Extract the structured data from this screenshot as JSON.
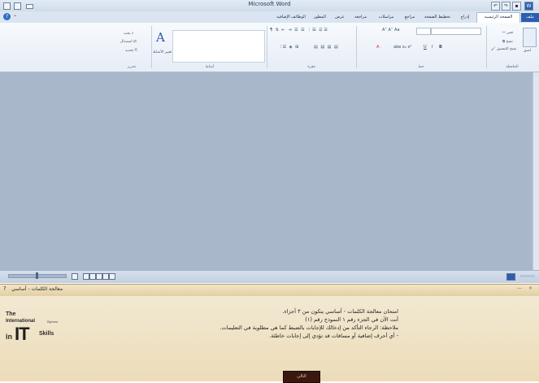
{
  "window": {
    "title": "Microsoft Word"
  },
  "ribbon_tabs": {
    "file": "ملف",
    "home": "الصفحة الرئيسية",
    "insert": "إدراج",
    "page_layout": "تخطيط الصفحة",
    "references": "مراجع",
    "mailings": "مراسلات",
    "review": "مراجعة",
    "view": "عرض",
    "developer": "المطور",
    "addins": "الوظائف الإضافية"
  },
  "clipboard": {
    "paste": "لصق",
    "cut": "قص",
    "copy": "نسخ",
    "format_painter": "نسخ التنسيق",
    "group_label": "الحافظة"
  },
  "font_group": {
    "label": "خط"
  },
  "paragraph_group": {
    "label": "فقرة"
  },
  "styles_group": {
    "label": "أنماط"
  },
  "editing_group": {
    "label": "تحرير",
    "find": "بحث",
    "replace": "استبدال",
    "select": "تحديد"
  },
  "change_styles_label": "تغيير الأنماط",
  "exam_panel": {
    "title": "معالجة الكلمات - أساسي",
    "logo": {
      "line1": "The",
      "line2": "International",
      "diploma": "Diploma",
      "in": "in",
      "it": "IT",
      "skills": "Skills"
    },
    "instructions": [
      "امتحان معالجة الكلمات - أساسي يتكون من ٣ أجزاء.",
      "أنت الآن في  الجزء رقم ١ النموذج رقم (١)",
      "ملاحظة: الرجاء التأكد من إدخالك للإجابات بالضبط كما هي مطلوبة في التعليمات.",
      "- أي أحرف إضافية أو مسافات قد تؤدي إلى إجابات خاطئة."
    ],
    "next_button": "التالي"
  },
  "icons": [
    "help-icon",
    "word-icon",
    "save-icon",
    "undo-icon",
    "redo-icon",
    "minimize-icon",
    "maximize-icon",
    "close-icon",
    "paste-icon",
    "cut-icon",
    "copy-icon",
    "format-painter-icon",
    "bold-icon",
    "italic-icon",
    "underline-icon",
    "bullets-icon",
    "numbering-icon",
    "align-right-icon",
    "align-center-icon",
    "align-left-icon",
    "justify-icon",
    "find-icon",
    "replace-icon",
    "select-icon",
    "styles-icon",
    "zoom-icon",
    "view-icon"
  ],
  "colors": {
    "file_tab": "#2b5fae",
    "doc_background": "#a9b7cb",
    "panel_background": "#ecdcb8",
    "next_button": "#3a1810"
  }
}
